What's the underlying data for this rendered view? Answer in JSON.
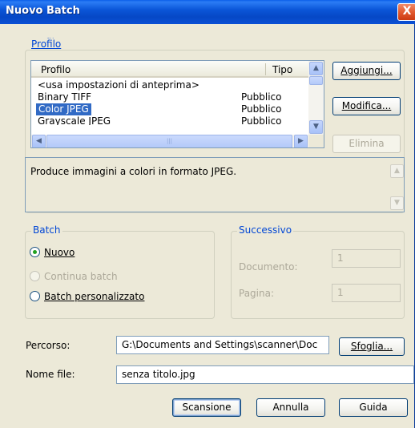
{
  "window": {
    "title": "Nuovo Batch",
    "close_glyph": "X"
  },
  "profilo_group": {
    "legend": "Profilo",
    "columns": [
      "Profilo",
      "Tipo"
    ],
    "rows": [
      {
        "name": "<usa impostazioni di anteprima>",
        "type": ""
      },
      {
        "name": "Binary TIFF",
        "type": "Pubblico"
      },
      {
        "name": "Color JPEG",
        "type": "Pubblico",
        "selected": true
      },
      {
        "name": "Grayscale JPEG",
        "type": "Pubblico"
      }
    ],
    "buttons": {
      "add": "Aggiungi...",
      "edit": "Modifica...",
      "delete": "Elimina"
    },
    "description": "Produce immagini a colori in formato JPEG."
  },
  "batch_group": {
    "legend": "Batch",
    "options": {
      "new": "Nuovo",
      "continue": "Continua batch",
      "custom": "Batch personalizzato"
    },
    "selected": "new"
  },
  "successivo_group": {
    "legend": "Successivo",
    "documento_label": "Documento:",
    "documento_value": "1",
    "pagina_label": "Pagina:",
    "pagina_value": "1"
  },
  "path": {
    "label": "Percorso:",
    "value": "G:\\Documents and Settings\\scanner\\Doc",
    "browse": "Sfoglia..."
  },
  "filename": {
    "label": "Nome file:",
    "value": "senza titolo.jpg"
  },
  "footer": {
    "scan": "Scansione",
    "cancel": "Annulla",
    "help": "Guida"
  },
  "colors": {
    "dialog_bg": "#ece9d8",
    "titlebar": "#0b56d8",
    "selection": "#316ac5",
    "legend_text": "#0046d5"
  },
  "icons": {
    "close": "close-icon",
    "scroll_up": "arrow-up-icon",
    "scroll_down": "arrow-down-icon",
    "scroll_left": "arrow-left-icon",
    "scroll_right": "arrow-right-icon"
  }
}
